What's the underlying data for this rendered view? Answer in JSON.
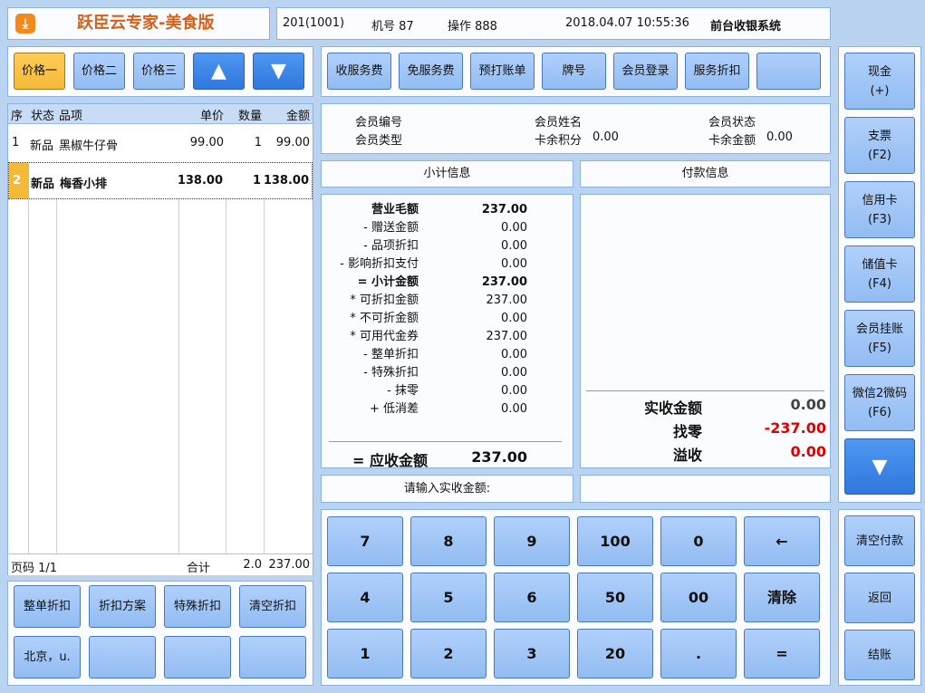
{
  "app": {
    "title": "跃臣云专家-美食版",
    "logo_icon": "download-arrow-icon"
  },
  "status": {
    "table": "201(1001)",
    "machine": "机号 87",
    "operator": "操作 888",
    "datetime": "2018.04.07 10:55:36",
    "system": "前台收银系统"
  },
  "price_tabs": [
    "价格一",
    "价格二",
    "价格三"
  ],
  "order": {
    "headers": [
      "序",
      "状态",
      "品项",
      "单价",
      "数量",
      "金额"
    ],
    "rows": [
      {
        "seq": "1",
        "status": "新品",
        "item": "黑椒牛仔骨",
        "price": "99.00",
        "qty": "1",
        "amount": "99.00"
      },
      {
        "seq": "2",
        "status": "新品",
        "item": "梅香小排",
        "price": "138.00",
        "qty": "1",
        "amount": "138.00"
      }
    ],
    "footer": {
      "page": "页码 1/1",
      "total_label": "合计",
      "total_qty": "2.0",
      "total_amount": "237.00"
    }
  },
  "left_buttons": [
    "整单折扣",
    "折扣方案",
    "特殊折扣",
    "清空折扣",
    "北京，u.",
    "",
    "",
    ""
  ],
  "toolbar": [
    "收服务费",
    "免服务费",
    "预打账单",
    "牌号",
    "会员登录",
    "服务折扣",
    ""
  ],
  "member": {
    "no_label": "会员编号",
    "name_label": "会员姓名",
    "status_label": "会员状态",
    "type_label": "会员类型",
    "points_label": "卡余积分",
    "points": "0.00",
    "balance_label": "卡余金额",
    "balance": "0.00"
  },
  "subtotal": {
    "title": "小计信息",
    "lines": [
      {
        "label": "营业毛额",
        "value": "237.00",
        "bold": true
      },
      {
        "label": "- 赠送金额",
        "value": "0.00"
      },
      {
        "label": "- 品项折扣",
        "value": "0.00"
      },
      {
        "label": "- 影响折扣支付",
        "value": "0.00"
      },
      {
        "label": "= 小计金额",
        "value": "237.00",
        "bold": true
      },
      {
        "label": "* 可折扣金额",
        "value": "237.00"
      },
      {
        "label": "* 不可折金额",
        "value": "0.00"
      },
      {
        "label": "* 可用代金券",
        "value": "237.00"
      },
      {
        "label": "- 整单折扣",
        "value": "0.00"
      },
      {
        "label": "- 特殊折扣",
        "value": "0.00"
      },
      {
        "label": "- 抹零",
        "value": "0.00"
      },
      {
        "label": "+ 低消差",
        "value": "0.00"
      }
    ],
    "due_label": "= 应收金额",
    "due_value": "237.00"
  },
  "payment": {
    "title": "付款信息",
    "received_label": "实收金额",
    "received": "0.00",
    "change_label": "找零",
    "change": "-237.00",
    "over_label": "溢收",
    "over": "0.00"
  },
  "input_prompt": "请输入实收金额:",
  "keypad": [
    [
      "7",
      "8",
      "9",
      "100",
      "0",
      "←"
    ],
    [
      "4",
      "5",
      "6",
      "50",
      "00",
      "清除"
    ],
    [
      "1",
      "2",
      "3",
      "20",
      ".",
      "="
    ]
  ],
  "pay_methods": [
    {
      "name": "现金",
      "key": "(+)"
    },
    {
      "name": "支票",
      "key": "(F2)"
    },
    {
      "name": "信用卡",
      "key": "(F3)"
    },
    {
      "name": "储值卡",
      "key": "(F4)"
    },
    {
      "name": "会员挂账",
      "key": "(F5)"
    },
    {
      "name": "微信2微码",
      "key": "(F6)"
    }
  ],
  "right_actions": [
    "清空付款",
    "返回",
    "结账"
  ],
  "colors": {
    "background": "#b9d3f1",
    "button": "#a3c7f7",
    "selected": "#f5b93a",
    "accent": "#2f78de",
    "title": "#d5611b",
    "negative": "#e00000"
  }
}
